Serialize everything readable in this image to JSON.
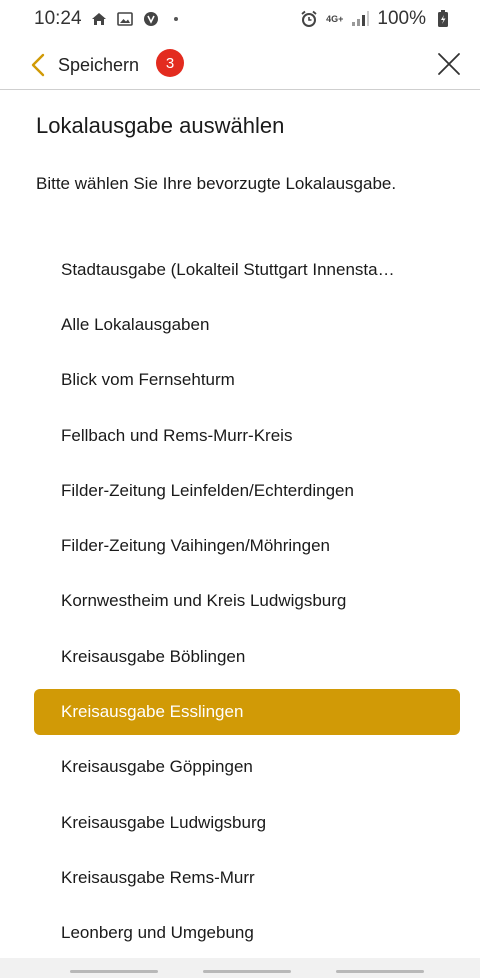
{
  "status_bar": {
    "time": "10:24",
    "network": "4G+",
    "battery": "100%",
    "icons": [
      "home-icon",
      "image-icon",
      "vpn-icon",
      "alarm-icon",
      "network-icon",
      "signal-icon",
      "battery-icon"
    ]
  },
  "header": {
    "back_label": "Speichern",
    "badge_count": "3",
    "close_icon": "close-icon"
  },
  "page": {
    "title": "Lokalausgabe auswählen",
    "subtitle": "Bitte wählen Sie Ihre bevorzugte Lokalausgabe."
  },
  "editions": [
    {
      "label": "Stadtausgabe (Lokalteil Stuttgart Innensta…",
      "selected": false
    },
    {
      "label": "Alle Lokalausgaben",
      "selected": false
    },
    {
      "label": "Blick vom Fernsehturm",
      "selected": false
    },
    {
      "label": "Fellbach und Rems-Murr-Kreis",
      "selected": false
    },
    {
      "label": "Filder-Zeitung Leinfelden/Echterdingen",
      "selected": false
    },
    {
      "label": "Filder-Zeitung Vaihingen/Möhringen",
      "selected": false
    },
    {
      "label": "Kornwestheim und Kreis Ludwigsburg",
      "selected": false
    },
    {
      "label": "Kreisausgabe Böblingen",
      "selected": false
    },
    {
      "label": "Kreisausgabe Esslingen",
      "selected": true
    },
    {
      "label": "Kreisausgabe Göppingen",
      "selected": false
    },
    {
      "label": "Kreisausgabe Ludwigsburg",
      "selected": false
    },
    {
      "label": "Kreisausgabe Rems-Murr",
      "selected": false
    },
    {
      "label": "Leonberg und Umgebung",
      "selected": false
    }
  ],
  "colors": {
    "accent": "#d19a06",
    "badge": "#e32b1f",
    "text": "#1a1a1a",
    "divider": "#cfcfcf"
  }
}
